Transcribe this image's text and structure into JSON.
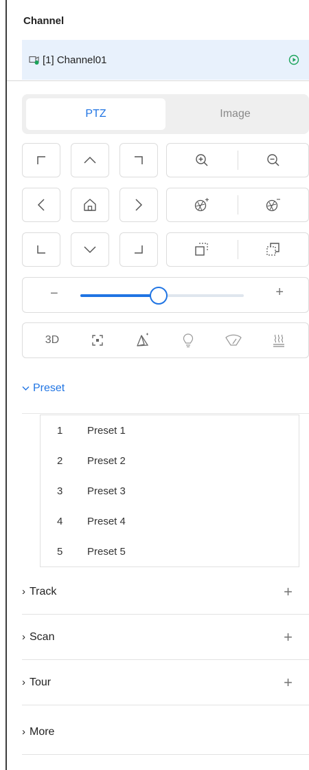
{
  "channel": {
    "title": "Channel",
    "selected": {
      "label": "[1] Channel01",
      "icon": "camera-icon",
      "status_icon": "play-circle-icon"
    }
  },
  "tabs": [
    {
      "label": "PTZ",
      "active": true
    },
    {
      "label": "Image",
      "active": false
    }
  ],
  "ptz": {
    "directions": [
      "up-left",
      "up",
      "up-right",
      "left",
      "home",
      "right",
      "down-left",
      "down",
      "down-right"
    ],
    "zoom": {
      "in_icon": "zoom-in-icon",
      "out_icon": "zoom-out-icon"
    },
    "iris": {
      "open_icon": "iris-plus-icon",
      "close_icon": "iris-minus-icon"
    },
    "focus": {
      "near_icon": "focus-near-icon",
      "far_icon": "focus-far-icon"
    },
    "speed": {
      "minus": "−",
      "plus": "+",
      "level": 0.48
    },
    "tools": [
      {
        "label": "3D",
        "icon": "3d-positioning-icon"
      },
      {
        "label": "",
        "icon": "focus-box-icon"
      },
      {
        "label": "",
        "icon": "auto-pan-icon"
      },
      {
        "label": "",
        "icon": "light-bulb-icon"
      },
      {
        "label": "",
        "icon": "wiper-icon"
      },
      {
        "label": "",
        "icon": "heater-icon"
      }
    ]
  },
  "preset": {
    "title": "Preset",
    "items": [
      {
        "num": "1",
        "name": "Preset 1"
      },
      {
        "num": "2",
        "name": "Preset 2"
      },
      {
        "num": "3",
        "name": "Preset 3"
      },
      {
        "num": "4",
        "name": "Preset 4"
      },
      {
        "num": "5",
        "name": "Preset 5"
      }
    ]
  },
  "sections": [
    {
      "label": "Track",
      "add": "+"
    },
    {
      "label": "Scan",
      "add": "+"
    },
    {
      "label": "Tour",
      "add": "+"
    },
    {
      "label": "More",
      "add": ""
    }
  ],
  "colors": {
    "accent": "#1f74e3",
    "selected_bg": "#e8f1fc",
    "status_green": "#1aa35a"
  }
}
